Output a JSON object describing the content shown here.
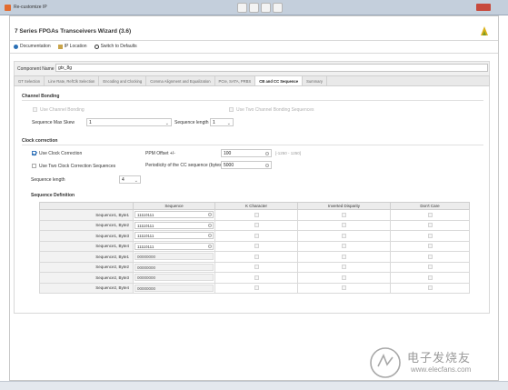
{
  "window": {
    "title": "Re-customize IP",
    "title_faded": ""
  },
  "app": {
    "title": "7 Series FPGAs Transceivers Wizard (3.6)"
  },
  "links": {
    "documentation": "Documentation",
    "ip_location": "IP Location",
    "switch_defaults": "Switch to Defaults"
  },
  "component": {
    "label": "Component Name",
    "value": "gtx_8g"
  },
  "tabs": [
    {
      "label": "GT Selection"
    },
    {
      "label": "Line Rate, RefClk Selection"
    },
    {
      "label": "Encoding and Clocking"
    },
    {
      "label": "Comma Alignment and Equalization"
    },
    {
      "label": "PCIe, SATA, PRBS"
    },
    {
      "label": "CB and CC Sequence"
    },
    {
      "label": "Summary"
    }
  ],
  "channel_bonding": {
    "heading": "Channel Bonding",
    "use_cb_label": "Use Channel Bonding",
    "use_two_cb_label": "Use Two Channel Bonding Sequences",
    "max_skew_label": "Sequence Max Skew",
    "max_skew_value": "1",
    "seq_length_label": "Sequence length",
    "seq_length_value": "1"
  },
  "clock_correction": {
    "heading": "Clock correction",
    "use_cc_label": "Use Clock Correction",
    "use_two_cc_label": "Use Two Clock Correction Sequences",
    "seq_length_label": "Sequence length",
    "seq_length_value": "4",
    "ppm_label": "PPM Offset +/-",
    "ppm_value": "100",
    "ppm_hint": "[-1250 - 1250]",
    "periodicity_label": "Periodicity of the CC sequence (bytes)",
    "periodicity_value": "5000"
  },
  "sequence_definition": {
    "heading": "Sequence Definition",
    "columns": [
      "",
      "Sequence",
      "K Character",
      "Inverted Disparity",
      "Don't Care"
    ],
    "rows": [
      {
        "label": "Sequence1, Byte1",
        "value": "11110111"
      },
      {
        "label": "Sequence1, Byte2",
        "value": "11110111"
      },
      {
        "label": "Sequence1, Byte3",
        "value": "11110111"
      },
      {
        "label": "Sequence1, Byte4",
        "value": "11110111"
      },
      {
        "label": "Sequence2, Byte1",
        "value": "00000000"
      },
      {
        "label": "Sequence2, Byte2",
        "value": "00000000"
      },
      {
        "label": "Sequence2, Byte3",
        "value": "00000000"
      },
      {
        "label": "Sequence2, Byte4",
        "value": "00000000"
      }
    ]
  },
  "watermark": {
    "top": "电子发烧友",
    "bottom": "www.elecfans.com"
  },
  "colors": {
    "accent": "#2f6fb3",
    "window_chrome": "#c4cfdc",
    "close_button": "#c7493c"
  }
}
